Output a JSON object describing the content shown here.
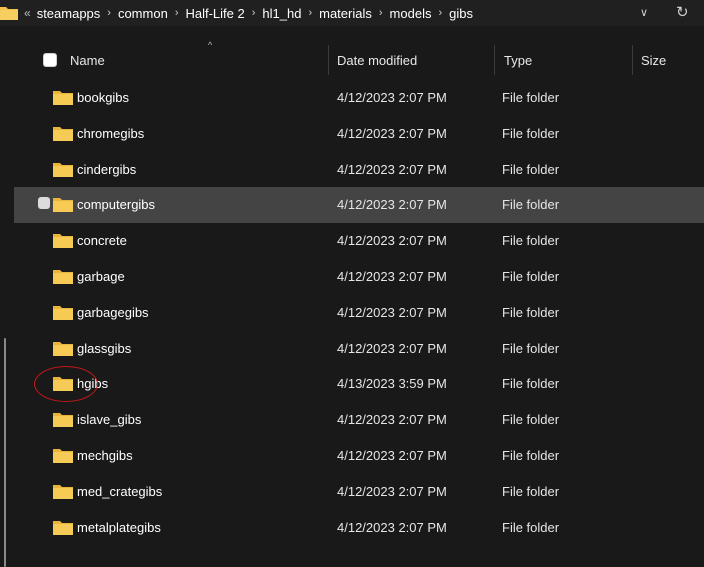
{
  "address_bar": {
    "overflow_label": "«",
    "crumbs": [
      "steamapps",
      "common",
      "Half-Life 2",
      "hl1_hd",
      "materials",
      "models",
      "gibs"
    ],
    "icons": {
      "folder": "folder-icon",
      "dropdown": "chevron-down-icon",
      "refresh": "refresh-icon"
    }
  },
  "columns": {
    "name": "Name",
    "date_modified": "Date modified",
    "type": "Type",
    "size": "Size"
  },
  "colors": {
    "folder": "#f3c04b",
    "selected_row": "#444444",
    "annotation": "#c21818"
  },
  "rows": [
    {
      "name": "bookgibs",
      "date": "4/12/2023 2:07 PM",
      "type": "File folder"
    },
    {
      "name": "chromegibs",
      "date": "4/12/2023 2:07 PM",
      "type": "File folder"
    },
    {
      "name": "cindergibs",
      "date": "4/12/2023 2:07 PM",
      "type": "File folder"
    },
    {
      "name": "computergibs",
      "date": "4/12/2023 2:07 PM",
      "type": "File folder",
      "selected": true
    },
    {
      "name": "concrete",
      "date": "4/12/2023 2:07 PM",
      "type": "File folder"
    },
    {
      "name": "garbage",
      "date": "4/12/2023 2:07 PM",
      "type": "File folder"
    },
    {
      "name": "garbagegibs",
      "date": "4/12/2023 2:07 PM",
      "type": "File folder"
    },
    {
      "name": "glassgibs",
      "date": "4/12/2023 2:07 PM",
      "type": "File folder"
    },
    {
      "name": "hgibs",
      "date": "4/13/2023 3:59 PM",
      "type": "File folder",
      "annotated": true
    },
    {
      "name": "islave_gibs",
      "date": "4/12/2023 2:07 PM",
      "type": "File folder"
    },
    {
      "name": "mechgibs",
      "date": "4/12/2023 2:07 PM",
      "type": "File folder"
    },
    {
      "name": "med_crategibs",
      "date": "4/12/2023 2:07 PM",
      "type": "File folder"
    },
    {
      "name": "metalplategibs",
      "date": "4/12/2023 2:07 PM",
      "type": "File folder"
    }
  ]
}
